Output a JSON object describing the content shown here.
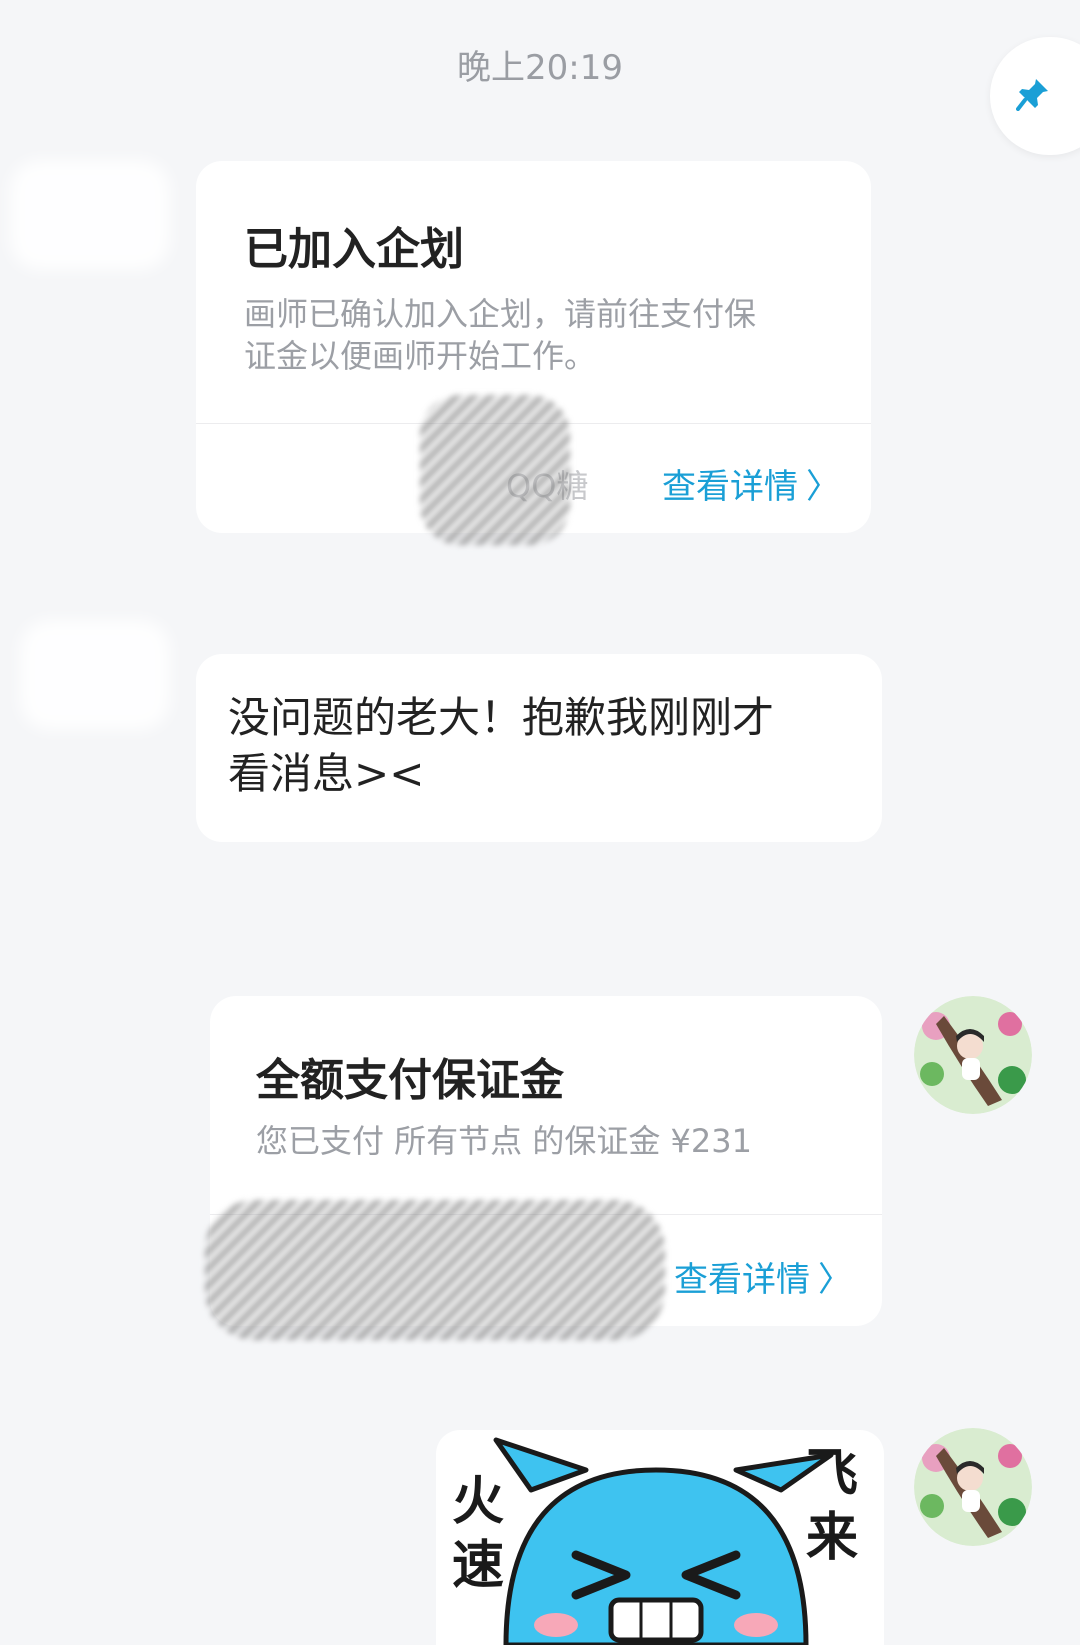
{
  "header": {
    "timestamp": "晚上20:19"
  },
  "messages": {
    "card1": {
      "title": "已加入企划",
      "desc_line1": "画师已确认加入企划，请前往支付保",
      "desc_line2": "证金以便画师开始工作。",
      "sender": "QQ糖",
      "link": "查看详情"
    },
    "text1": {
      "line1": "没问题的老大！抱歉我刚刚才",
      "line2": "看消息><"
    },
    "card2": {
      "title": "全额支付保证金",
      "desc": "您已支付 所有节点 的保证金 ¥231",
      "link": "查看详情"
    },
    "sticker": {
      "left_text": "火速",
      "right_text": "飞来"
    }
  },
  "icons": {
    "pin": "pin-icon",
    "chevron": "chevron-right-icon"
  },
  "colors": {
    "link": "#1a9fd6",
    "background": "#f5f6f8",
    "sticker_blue": "#3ec3f0"
  }
}
